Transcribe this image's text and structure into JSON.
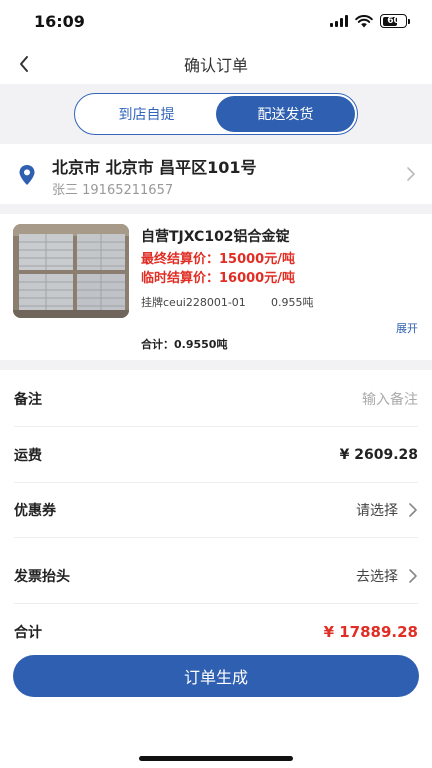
{
  "status_bar": {
    "time": "16:09",
    "battery": "60"
  },
  "nav": {
    "title": "确认订单"
  },
  "delivery_tabs": [
    {
      "label": "到店自提",
      "active": false
    },
    {
      "label": "配送发货",
      "active": true
    }
  ],
  "address": {
    "line": "北京市 北京市 昌平区101号",
    "contact": "张三 19165211657"
  },
  "product": {
    "name": "自营TJXC102铝合金锭",
    "final_price": "最终结算价：15000元/吨",
    "temp_price": "临时结算价：16000元/吨",
    "listing_code": "挂牌ceui228001-01",
    "weight": "0.955吨",
    "expand_label": "展开",
    "subtotal": "合计：0.9550吨"
  },
  "form": {
    "remark": {
      "label": "备注",
      "placeholder": "输入备注"
    },
    "freight": {
      "label": "运费",
      "value": "¥ 2609.28"
    },
    "coupon": {
      "label": "优惠券",
      "value": "请选择"
    },
    "invoice": {
      "label": "发票抬头",
      "value": "去选择"
    },
    "total": {
      "label": "合计",
      "value": "¥ 17889.28"
    }
  },
  "submit_label": "订单生成",
  "colors": {
    "brand_blue": "#2f5fb0",
    "price_red": "#e02e24",
    "bg_gray": "#f2f2f4"
  },
  "icons": [
    "back-icon",
    "location-pin-icon",
    "chevron-right-icon",
    "signal-icon",
    "wifi-icon",
    "battery-icon"
  ]
}
